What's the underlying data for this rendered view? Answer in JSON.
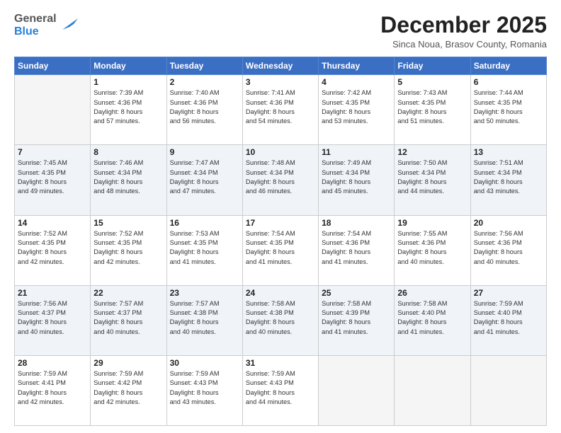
{
  "header": {
    "logo_general": "General",
    "logo_blue": "Blue",
    "month_title": "December 2025",
    "subtitle": "Sinca Noua, Brasov County, Romania"
  },
  "weekdays": [
    "Sunday",
    "Monday",
    "Tuesday",
    "Wednesday",
    "Thursday",
    "Friday",
    "Saturday"
  ],
  "weeks": [
    [
      {
        "day": "",
        "info": ""
      },
      {
        "day": "1",
        "info": "Sunrise: 7:39 AM\nSunset: 4:36 PM\nDaylight: 8 hours\nand 57 minutes."
      },
      {
        "day": "2",
        "info": "Sunrise: 7:40 AM\nSunset: 4:36 PM\nDaylight: 8 hours\nand 56 minutes."
      },
      {
        "day": "3",
        "info": "Sunrise: 7:41 AM\nSunset: 4:36 PM\nDaylight: 8 hours\nand 54 minutes."
      },
      {
        "day": "4",
        "info": "Sunrise: 7:42 AM\nSunset: 4:35 PM\nDaylight: 8 hours\nand 53 minutes."
      },
      {
        "day": "5",
        "info": "Sunrise: 7:43 AM\nSunset: 4:35 PM\nDaylight: 8 hours\nand 51 minutes."
      },
      {
        "day": "6",
        "info": "Sunrise: 7:44 AM\nSunset: 4:35 PM\nDaylight: 8 hours\nand 50 minutes."
      }
    ],
    [
      {
        "day": "7",
        "info": "Sunrise: 7:45 AM\nSunset: 4:35 PM\nDaylight: 8 hours\nand 49 minutes."
      },
      {
        "day": "8",
        "info": "Sunrise: 7:46 AM\nSunset: 4:34 PM\nDaylight: 8 hours\nand 48 minutes."
      },
      {
        "day": "9",
        "info": "Sunrise: 7:47 AM\nSunset: 4:34 PM\nDaylight: 8 hours\nand 47 minutes."
      },
      {
        "day": "10",
        "info": "Sunrise: 7:48 AM\nSunset: 4:34 PM\nDaylight: 8 hours\nand 46 minutes."
      },
      {
        "day": "11",
        "info": "Sunrise: 7:49 AM\nSunset: 4:34 PM\nDaylight: 8 hours\nand 45 minutes."
      },
      {
        "day": "12",
        "info": "Sunrise: 7:50 AM\nSunset: 4:34 PM\nDaylight: 8 hours\nand 44 minutes."
      },
      {
        "day": "13",
        "info": "Sunrise: 7:51 AM\nSunset: 4:34 PM\nDaylight: 8 hours\nand 43 minutes."
      }
    ],
    [
      {
        "day": "14",
        "info": "Sunrise: 7:52 AM\nSunset: 4:35 PM\nDaylight: 8 hours\nand 42 minutes."
      },
      {
        "day": "15",
        "info": "Sunrise: 7:52 AM\nSunset: 4:35 PM\nDaylight: 8 hours\nand 42 minutes."
      },
      {
        "day": "16",
        "info": "Sunrise: 7:53 AM\nSunset: 4:35 PM\nDaylight: 8 hours\nand 41 minutes."
      },
      {
        "day": "17",
        "info": "Sunrise: 7:54 AM\nSunset: 4:35 PM\nDaylight: 8 hours\nand 41 minutes."
      },
      {
        "day": "18",
        "info": "Sunrise: 7:54 AM\nSunset: 4:36 PM\nDaylight: 8 hours\nand 41 minutes."
      },
      {
        "day": "19",
        "info": "Sunrise: 7:55 AM\nSunset: 4:36 PM\nDaylight: 8 hours\nand 40 minutes."
      },
      {
        "day": "20",
        "info": "Sunrise: 7:56 AM\nSunset: 4:36 PM\nDaylight: 8 hours\nand 40 minutes."
      }
    ],
    [
      {
        "day": "21",
        "info": "Sunrise: 7:56 AM\nSunset: 4:37 PM\nDaylight: 8 hours\nand 40 minutes."
      },
      {
        "day": "22",
        "info": "Sunrise: 7:57 AM\nSunset: 4:37 PM\nDaylight: 8 hours\nand 40 minutes."
      },
      {
        "day": "23",
        "info": "Sunrise: 7:57 AM\nSunset: 4:38 PM\nDaylight: 8 hours\nand 40 minutes."
      },
      {
        "day": "24",
        "info": "Sunrise: 7:58 AM\nSunset: 4:38 PM\nDaylight: 8 hours\nand 40 minutes."
      },
      {
        "day": "25",
        "info": "Sunrise: 7:58 AM\nSunset: 4:39 PM\nDaylight: 8 hours\nand 41 minutes."
      },
      {
        "day": "26",
        "info": "Sunrise: 7:58 AM\nSunset: 4:40 PM\nDaylight: 8 hours\nand 41 minutes."
      },
      {
        "day": "27",
        "info": "Sunrise: 7:59 AM\nSunset: 4:40 PM\nDaylight: 8 hours\nand 41 minutes."
      }
    ],
    [
      {
        "day": "28",
        "info": "Sunrise: 7:59 AM\nSunset: 4:41 PM\nDaylight: 8 hours\nand 42 minutes."
      },
      {
        "day": "29",
        "info": "Sunrise: 7:59 AM\nSunset: 4:42 PM\nDaylight: 8 hours\nand 42 minutes."
      },
      {
        "day": "30",
        "info": "Sunrise: 7:59 AM\nSunset: 4:43 PM\nDaylight: 8 hours\nand 43 minutes."
      },
      {
        "day": "31",
        "info": "Sunrise: 7:59 AM\nSunset: 4:43 PM\nDaylight: 8 hours\nand 44 minutes."
      },
      {
        "day": "",
        "info": ""
      },
      {
        "day": "",
        "info": ""
      },
      {
        "day": "",
        "info": ""
      }
    ]
  ]
}
